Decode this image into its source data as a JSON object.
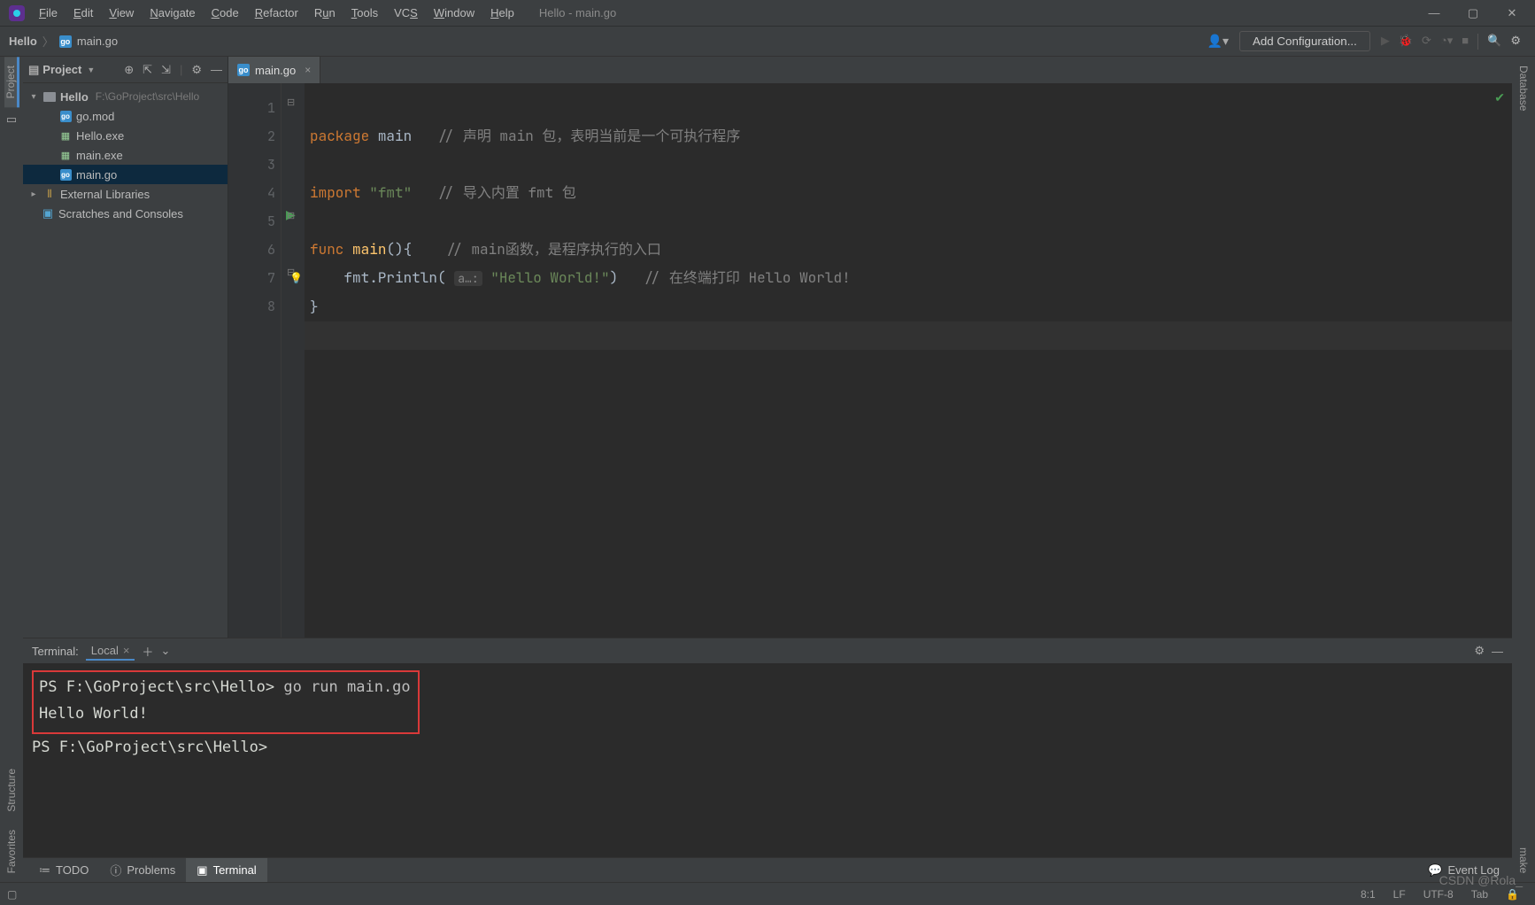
{
  "window": {
    "title": "Hello - main.go"
  },
  "menu": [
    "File",
    "Edit",
    "View",
    "Navigate",
    "Code",
    "Refactor",
    "Run",
    "Tools",
    "VCS",
    "Window",
    "Help"
  ],
  "breadcrumb": {
    "project": "Hello",
    "file": "main.go"
  },
  "toolbar": {
    "add_configuration": "Add Configuration..."
  },
  "project_panel": {
    "title": "Project"
  },
  "tree": {
    "root": {
      "name": "Hello",
      "path": "F:\\GoProject\\src\\Hello"
    },
    "children": [
      {
        "name": "go.mod",
        "icon": "go"
      },
      {
        "name": "Hello.exe",
        "icon": "exe"
      },
      {
        "name": "main.exe",
        "icon": "exe"
      },
      {
        "name": "main.go",
        "icon": "go",
        "selected": true
      }
    ],
    "external": "External Libraries",
    "scratches": "Scratches and Consoles"
  },
  "editor": {
    "tab": "main.go",
    "lines": [
      "1",
      "2",
      "3",
      "4",
      "5",
      "6",
      "7",
      "8"
    ],
    "code": {
      "l1_pkg": "package",
      "l1_main": "main",
      "l1_cm": "// 声明 main 包，表明当前是一个可执行程序",
      "l3_import": "import",
      "l3_str": "\"fmt\"",
      "l3_cm": "// 导入内置 fmt 包",
      "l5_func": "func",
      "l5_name": "main",
      "l5_pr": "(){",
      "l5_cm": "// main函数，是程序执行的入口",
      "l6_call": "fmt.Println(",
      "l6_hint": "a…:",
      "l6_str": "\"Hello World!\"",
      "l6_close": ")",
      "l6_cm": "// 在终端打印 Hello World!",
      "l7": "}"
    }
  },
  "terminal": {
    "title": "Terminal:",
    "tab": "Local",
    "line1_prompt": "PS F:\\GoProject\\src\\Hello>",
    "line1_cmd": "go run main.go",
    "line2": "Hello World!",
    "line3": "PS F:\\GoProject\\src\\Hello>"
  },
  "tools": {
    "todo": "TODO",
    "problems": "Problems",
    "terminal": "Terminal",
    "eventlog": "Event Log"
  },
  "leftstrip": {
    "project": "Project",
    "structure": "Structure",
    "favorites": "Favorites"
  },
  "rightstrip": {
    "database": "Database",
    "make": "make"
  },
  "status": {
    "pos": "8:1",
    "le": "LF",
    "enc": "UTF-8",
    "indent": "Tab"
  },
  "watermark": "CSDN @Rola_"
}
